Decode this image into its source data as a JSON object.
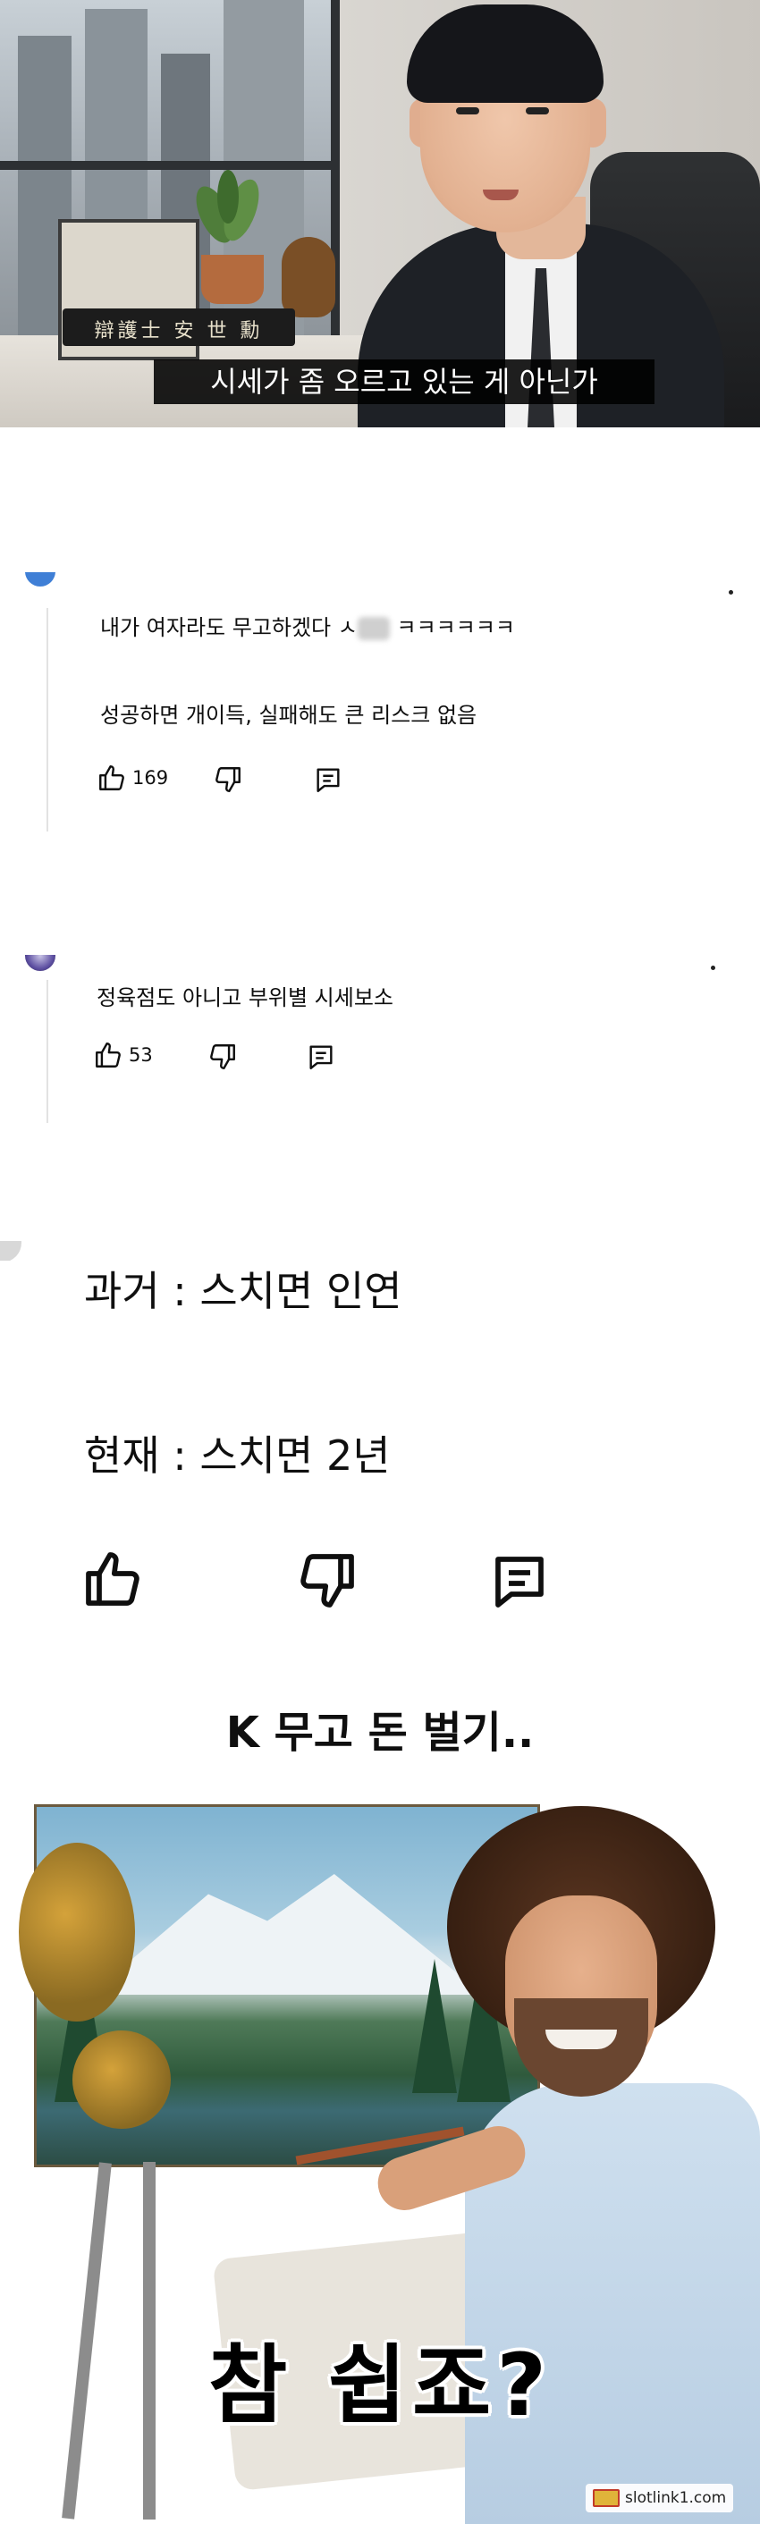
{
  "video": {
    "subtitle": "시세가 좀 오르고 있는 게 아닌가",
    "nameplate": "辯護士 安 世 勳"
  },
  "comments": [
    {
      "line1_prefix": "내가 여자라도 무고하겠다 ㅅ",
      "line1_suffix": "ㅋㅋㅋㅋㅋㅋ",
      "line2": "성공하면 개이득, 실패해도 큰 리스크 없음",
      "likes": "169"
    },
    {
      "text": "정육점도 아니고 부위별 시세보소",
      "likes": "53"
    },
    {
      "line1": "과거 : 스치면 인연",
      "line2": "현재 : 스치면 2년"
    }
  ],
  "heading": "K 무고 돈 벌기..",
  "meme": {
    "caption": "참 쉽죠?",
    "watermark": "slotlink1.com"
  },
  "icons": [
    "thumbs-up-icon",
    "thumbs-down-icon",
    "reply-icon",
    "more-icon"
  ]
}
